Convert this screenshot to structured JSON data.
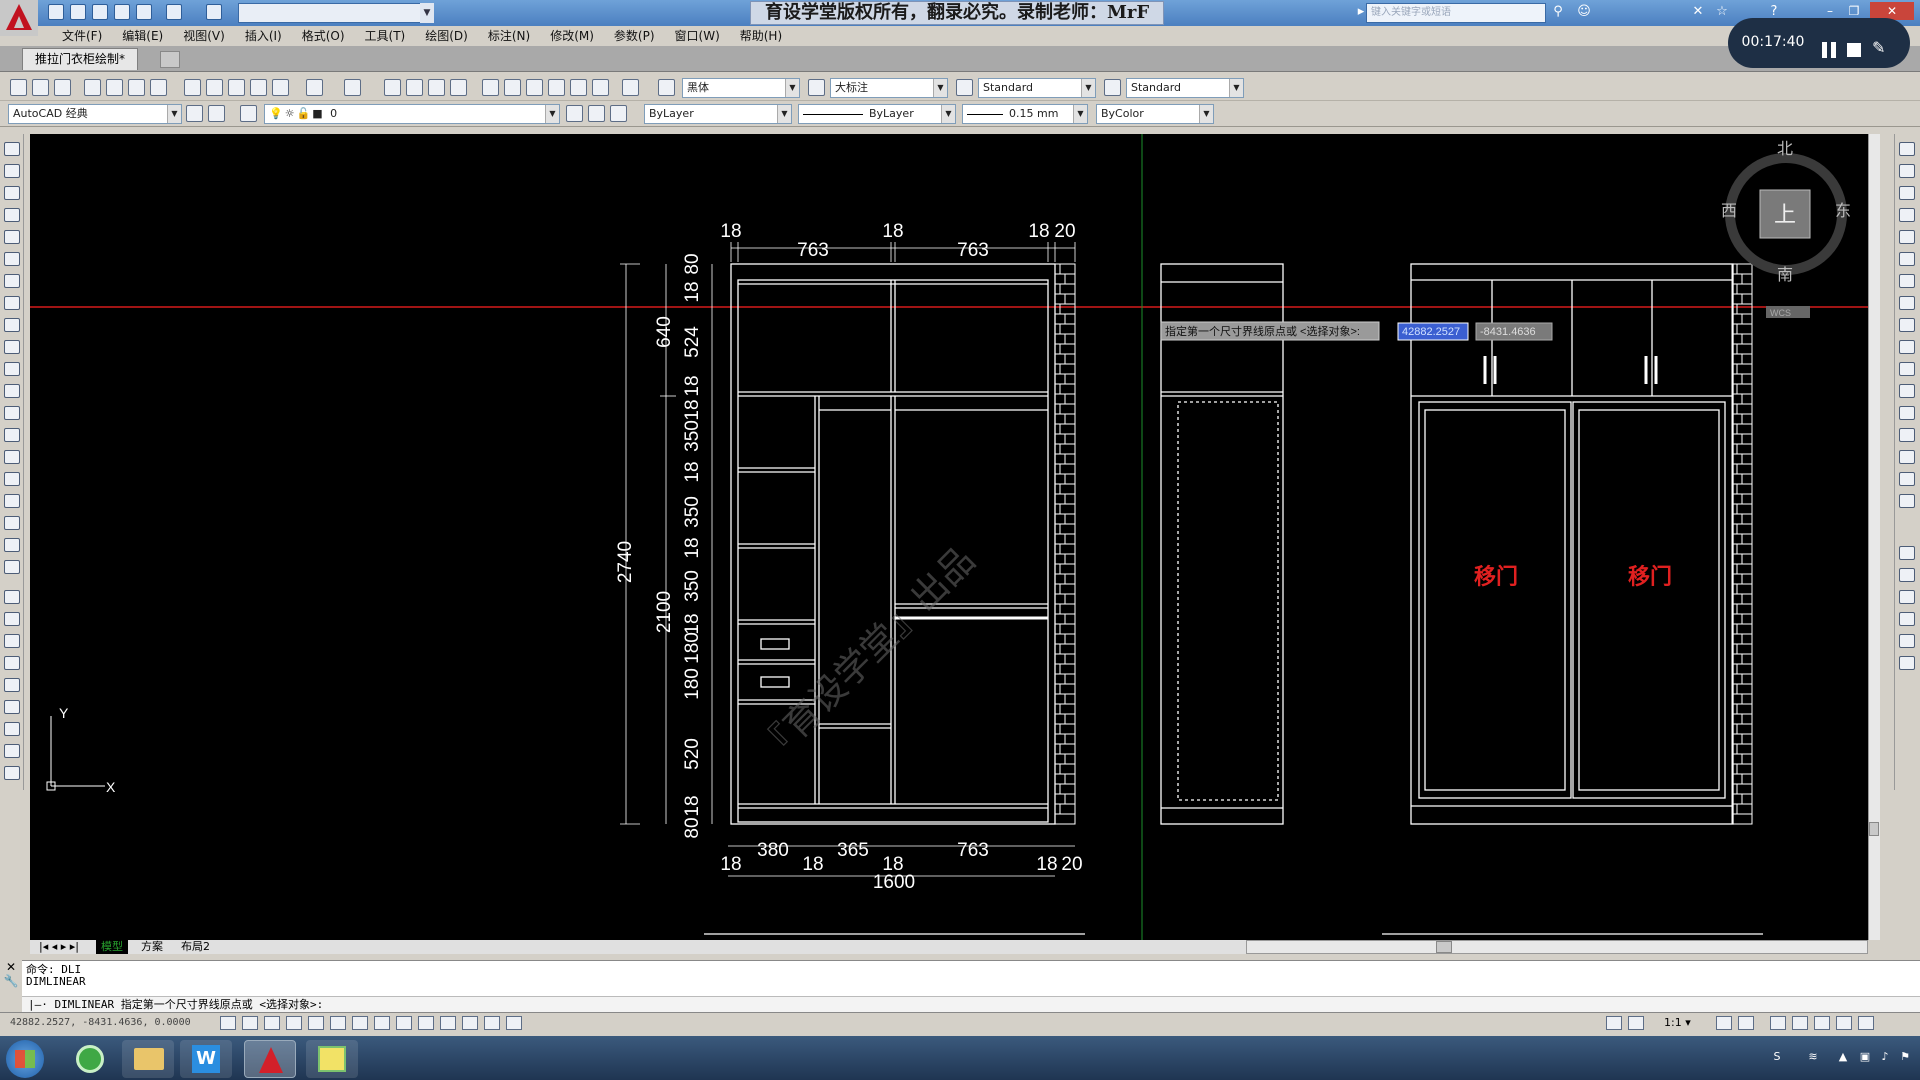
{
  "app": {
    "title": "育设学堂版权所有，翻录必究。录制老师：MrF",
    "search_placeholder": "键入关键字或短语",
    "document_tab": "推拉门衣柜绘制*"
  },
  "menu": [
    "文件(F)",
    "编辑(E)",
    "视图(V)",
    "插入(I)",
    "格式(O)",
    "工具(T)",
    "绘图(D)",
    "标注(N)",
    "修改(M)",
    "参数(P)",
    "窗口(W)",
    "帮助(H)"
  ],
  "recorder": {
    "time": "00:17:40"
  },
  "toolbar1": {
    "text_style": "黑体",
    "dim_style": "大标注",
    "table_style": "Standard",
    "mleader_style": "Standard"
  },
  "toolbar2": {
    "workspace": "AutoCAD 经典",
    "layer": "0",
    "color": "ByLayer",
    "linetype": "ByLayer",
    "lineweight": "0.15 mm",
    "plotstyle": "ByColor"
  },
  "viewcube": {
    "north": "北",
    "south": "南",
    "east": "东",
    "west": "西",
    "top": "上",
    "wcs": "WCS"
  },
  "tooltip": {
    "prompt": "指定第一个尺寸界线原点或 <选择对象>:",
    "x_value": "42882.2527",
    "y_value": "-8431.4636"
  },
  "drawing": {
    "top_dims": [
      "18",
      "763",
      "18",
      "763",
      "18",
      "20"
    ],
    "left_outer": [
      "2740"
    ],
    "left_mid": [
      "640",
      "2100"
    ],
    "left_inner": [
      "80",
      "18",
      "524",
      "18",
      "18",
      "350",
      "18",
      "350",
      "18",
      "350",
      "18",
      "180",
      "180",
      "520",
      "18",
      "80"
    ],
    "bottom_dims_upper": [
      "380",
      "365",
      "763"
    ],
    "bottom_dims_lower": [
      "18",
      "18",
      "18",
      "18",
      "20"
    ],
    "total_width": "1600",
    "door_label": "移门",
    "watermark": "『育设学堂』出品"
  },
  "ucs": {
    "x": "X",
    "y": "Y"
  },
  "layout_tabs": [
    "模型",
    "方案",
    "布局2"
  ],
  "command": {
    "history_1": "命令: DLI",
    "history_2": "DIMLINEAR",
    "current": "DIMLINEAR 指定第一个尺寸界线原点或 <选择对象>:"
  },
  "status": {
    "coords": "42882.2527, -8431.4636, 0.0000",
    "scale": "1:1"
  },
  "colors": {
    "canvas": "#000000",
    "crosshair": "#ff2020",
    "door_text": "#e02020",
    "linework": "#ffffff"
  }
}
